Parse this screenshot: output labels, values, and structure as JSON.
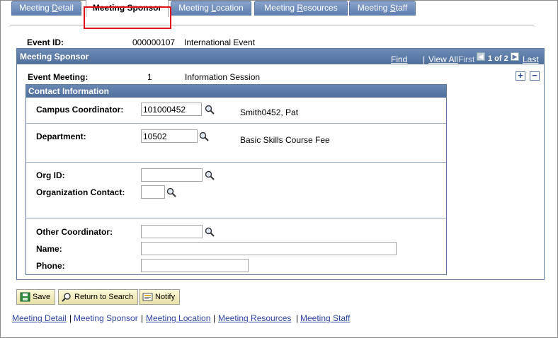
{
  "tabs": [
    {
      "label_pre": "Meeting ",
      "label_u": "D",
      "label_post": "etail"
    },
    {
      "label": "Meeting Sponsor"
    },
    {
      "label_pre": "Meeting ",
      "label_u": "L",
      "label_post": "ocation"
    },
    {
      "label_pre": "Meeting ",
      "label_u": "R",
      "label_post": "esources"
    },
    {
      "label_pre": "Meeting ",
      "label_u": "S",
      "label_post": "taff"
    }
  ],
  "event": {
    "id_label": "Event ID:",
    "id_value": "000000107",
    "name": "International Event"
  },
  "sponsor_panel": {
    "title": "Meeting Sponsor",
    "find": "Find",
    "view_all": "View All",
    "first": "First",
    "count": "1 of 2",
    "last": "Last",
    "event_meeting_label": "Event Meeting:",
    "event_meeting_num": "1",
    "event_meeting_name": "Information Session",
    "add_symbol": "+",
    "remove_symbol": "−",
    "prev_symbol": "◀",
    "next_symbol": "▶"
  },
  "contact": {
    "title": "Contact Information",
    "campus_coordinator_label": "Campus Coordinator:",
    "campus_coordinator_value": "101000452",
    "campus_coordinator_name": "Smith0452, Pat",
    "department_label": "Department:",
    "department_value": "10502",
    "department_desc": "Basic Skills Course Fee",
    "org_id_label": "Org ID:",
    "org_id_value": "",
    "org_contact_label": "Organization Contact:",
    "org_contact_value": "",
    "other_coordinator_label": "Other Coordinator:",
    "other_coordinator_value": "",
    "name_label": "Name:",
    "name_value": "",
    "phone_label": "Phone:",
    "phone_value": ""
  },
  "buttons": {
    "save": "Save",
    "return_to_search": "Return to Search",
    "notify": "Notify"
  },
  "footer_links": {
    "detail": "Meeting Detail",
    "sponsor": "Meeting Sponsor",
    "location": "Meeting Location",
    "resources": "Meeting Resources",
    "staff": "Meeting Staff",
    "separator": "|"
  },
  "colors": {
    "tab_blue": "#6b8ab5",
    "panel_header": "#5f7fa8",
    "highlight_red": "#e0101a",
    "link_blue": "#2f47a0",
    "button_yellow": "#f2efc3"
  },
  "icons": [
    "lookup-icon",
    "save-icon",
    "return-to-search-icon",
    "notify-icon",
    "add-row-icon",
    "delete-row-icon",
    "previous-arrow-icon",
    "next-arrow-icon"
  ]
}
